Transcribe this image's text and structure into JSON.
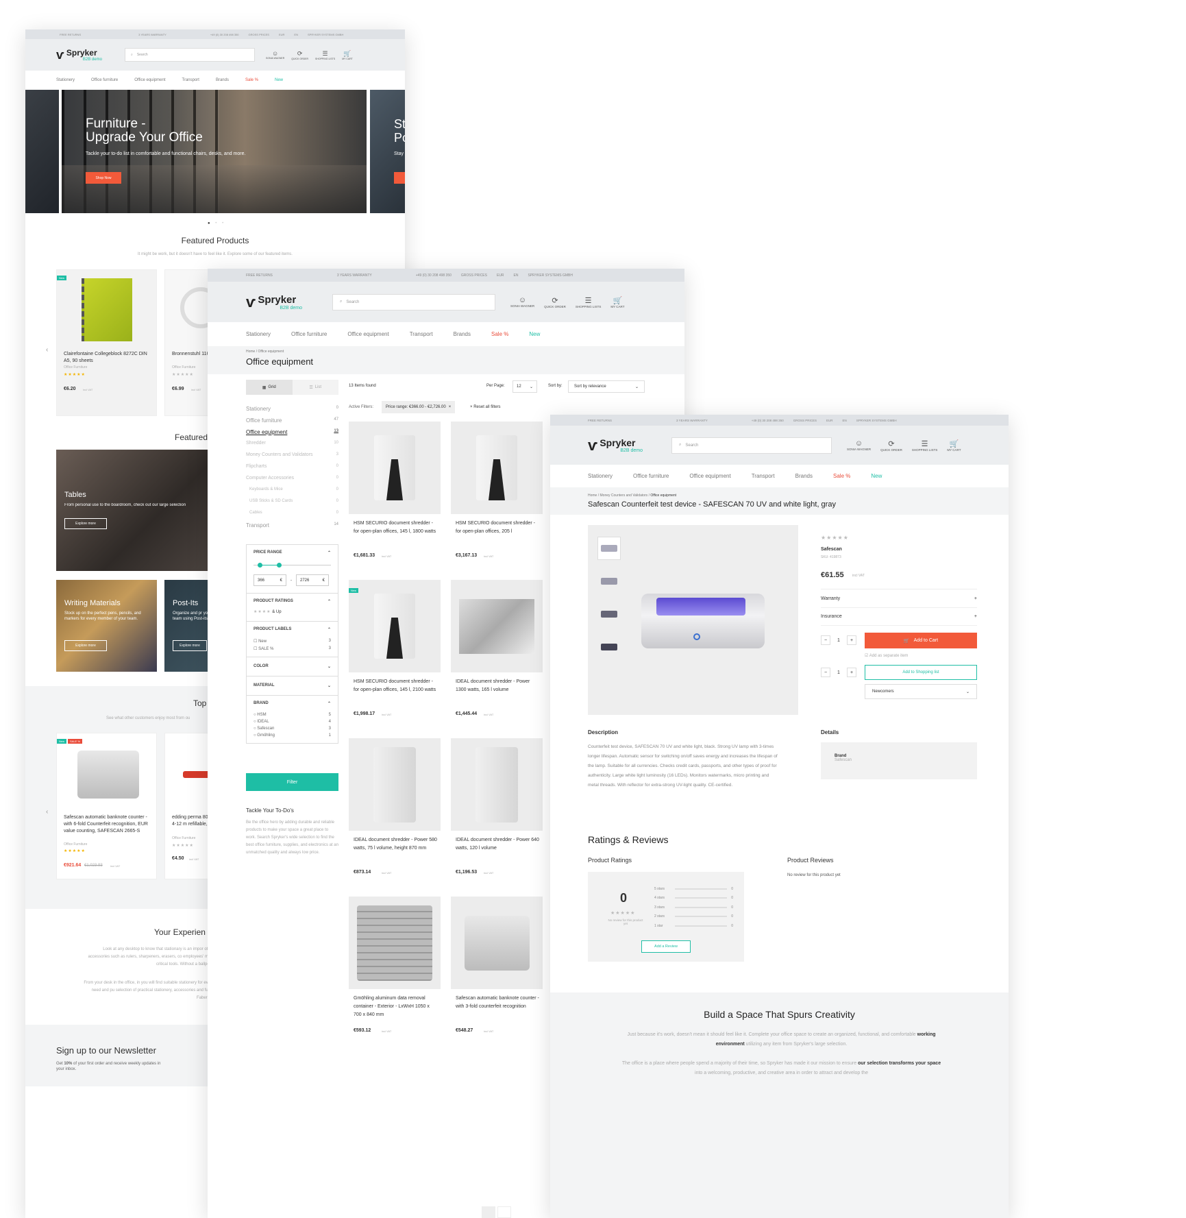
{
  "topbar": {
    "free_returns": "FREE RETURNS",
    "warranty": "3 YEARS WARRANTY",
    "phone": "+49 (0) 30 208 498 350",
    "gross_prices": "GROSS PRICES",
    "currency": "EUR",
    "language": "EN",
    "company": "SPRYKER SYSTEMS GMBH"
  },
  "header": {
    "logo_name": "Spryker",
    "logo_sub": "B2B demo",
    "search_placeholder": "Search",
    "user": "SONIA WAGNER",
    "quick_order": "QUICK ORDER",
    "shopping_lists": "SHOPPING LISTS",
    "cart": "MY CART",
    "cart_count": "3"
  },
  "nav": {
    "stationery": "Stationery",
    "office_furniture": "Office furniture",
    "office_equipment": "Office equipment",
    "transport": "Transport",
    "brands": "Brands",
    "sale": "Sale %",
    "new": "New"
  },
  "home": {
    "hero_title_1": "Furniture -",
    "hero_title_2": "Upgrade Your Office",
    "hero_text": "Tackle your to-do list in comfortable and functional chairs, desks, and more.",
    "hero_button": "Shop Now",
    "next_hero_1": "St",
    "next_hero_2": "Po",
    "next_hero_3": "Stay",
    "featured_title": "Featured Products",
    "featured_sub": "It might be work, but it doesn't have to feel like it. Explore some of our featured items.",
    "featured": [
      {
        "badge": "New",
        "name": "Clairefontaine Collegeblock 8272C DIN A5, 90 sheets",
        "category": "Office Furniture",
        "price": "€6.20",
        "vat": "incl VAT"
      },
      {
        "badge": "",
        "name": "Bronnenstuhl 1162180 3 m, b",
        "category": "Office Furniture",
        "price": "€6.99",
        "vat": "incl VAT"
      }
    ],
    "featured_cat_title": "Featured",
    "tables_title": "Tables",
    "tables_text": "From personal use to the boardroom, check out our large selection",
    "explore_more": "Explore more",
    "writing_title": "Writing Materials",
    "writing_text": "Stock up on the perfect pens, pencils, and markers for every member of your team.",
    "postits_title": "Post-Its",
    "postits_text": "Organize and pr your team using Post-its.",
    "top_title": "Top",
    "top_sub": "See what other customers enjoy most from ou",
    "top": [
      {
        "badge_new": "New",
        "badge_sale": "SALE %",
        "name": "Safescan automatic banknote counter - with 6-fold Counterfeit recognition, EUR value counting, SAFESCAN 2665-S",
        "category": "Office Furniture",
        "price": "€921.64",
        "old_price": "€1,023.93",
        "vat": "incl VAT"
      },
      {
        "name": "edding perma 800004 4-12 m refillable, blac",
        "category": "Office Furniture",
        "price": "€4.50",
        "vat": "incl VAT"
      }
    ],
    "experience_title": "Your Experien",
    "experience_p1": "Look at any desktop to know that stationary is an impor other accessories such as rulers, sharpeners, erasers, co employees' most critical tools. Without a ballpoint",
    "experience_p2": "From your desk in the office, in you will find suitable stationery for every need and pu selection of practical stationery, accessories and furnit Faber Ca",
    "newsletter_title": "Sign up to our Newsletter",
    "newsletter_text_1": "Get",
    "newsletter_bold": "10%",
    "newsletter_text_2": "of your first order and receive weekly updates in your inbox."
  },
  "catalog": {
    "breadcrumb_home": "Home",
    "breadcrumb_current": "Office equipment",
    "title": "Office equipment",
    "grid": "Grid",
    "list": "List",
    "items_found": "13 Items found",
    "per_page_label": "Per Page:",
    "per_page": "12",
    "sort_label": "Sort by:",
    "sort_value": "Sort by relevance",
    "active_filters": "Active Filters:",
    "price_range_chip": "Price range: €366.00 - €2,726.00",
    "reset_filters": "Reset all filters",
    "categories": [
      {
        "name": "Stationery",
        "count": "0"
      },
      {
        "name": "Office furniture",
        "count": "47"
      },
      {
        "name": "Office equipment",
        "count": "13"
      },
      {
        "name": "Shredder",
        "count": "10"
      },
      {
        "name": "Money Counters and Validators",
        "count": "3"
      },
      {
        "name": "Flipcharts",
        "count": "0"
      },
      {
        "name": "Computer Accessories",
        "count": "0"
      },
      {
        "name": "Keyboards & Mice",
        "count": "0"
      },
      {
        "name": "USB Sticks & SD Cards",
        "count": "0"
      },
      {
        "name": "Cables",
        "count": "0"
      },
      {
        "name": "Transport",
        "count": "14"
      }
    ],
    "price_range_label": "PRICE RANGE",
    "price_min": "366",
    "price_max": "2726",
    "price_unit": "€",
    "price_dash": "-",
    "ratings_label": "PRODUCT RATINGS",
    "ratings_up": "& Up",
    "labels_label": "PRODUCT LABELS",
    "label_new": "New",
    "label_new_count": "3",
    "label_sale": "SALE %",
    "label_sale_count": "3",
    "color_label": "COLOR",
    "material_label": "MATERIAL",
    "brand_label": "BRAND",
    "brands": [
      {
        "name": "HSM",
        "count": "5"
      },
      {
        "name": "IDEAL",
        "count": "4"
      },
      {
        "name": "Safescan",
        "count": "3"
      },
      {
        "name": "Gmöhling",
        "count": "1"
      }
    ],
    "filter_button": "Filter",
    "seo_title": "Tackle Your To-Do's",
    "seo_text": "Be the office hero by adding durable and reliable products to make your space a great place to work. Search Spryker's wide selection to find the best office furniture, supplies, and electronics at an unmatched quality and always low price.",
    "products": [
      {
        "name": "HSM SECURIO document shredder - for open-plan offices, 145 l, 1800 watts",
        "price": "€1,681.33",
        "vat": "incl VAT",
        "badge": ""
      },
      {
        "name": "HSM SECURIO document shredder - for open-plan offices, 205 l",
        "price": "€3,167.13",
        "vat": "incl VAT",
        "badge": ""
      },
      {
        "name": "HSM SECURIO document shredder - for open-plan offices, 145 l, 2100 watts",
        "price": "€1,998.17",
        "vat": "incl VAT",
        "badge": "New"
      },
      {
        "name": "IDEAL document shredder - Power 1300 watts, 165 l volume",
        "price": "€1,445.44",
        "vat": "incl VAT",
        "badge": ""
      },
      {
        "name": "IDEAL document shredder - Power 580 watts, 75 l volume, height 870 mm",
        "price": "€873.14",
        "vat": "incl VAT",
        "badge": ""
      },
      {
        "name": "IDEAL document shredder - Power 640 watts, 120 l volume",
        "price": "€1,196.53",
        "vat": "incl VAT",
        "badge": ""
      },
      {
        "name": "Gmöhling aluminum data removal container - Exterior - LxWxH 1050 x 700 x 840 mm",
        "price": "€593.12",
        "vat": "incl VAT",
        "badge": ""
      },
      {
        "name": "Safescan automatic banknote counter - with 3-fold counterfeit recognition",
        "price": "€548.27",
        "vat": "incl VAT",
        "badge": ""
      }
    ]
  },
  "pdp": {
    "breadcrumb_home": "Home",
    "breadcrumb_mid": "Money Counters and Validators",
    "breadcrumb_current": "Office equipment",
    "title": "Safescan Counterfeit test device - SAFESCAN 70 UV and white light, gray",
    "brand": "Safescan",
    "sku": "SKU: 419873",
    "price": "€61.55",
    "vat": "incl VAT",
    "warranty": "Warranty",
    "insurance": "Insurance",
    "qty": "1",
    "add_to_cart": "Add to Cart",
    "separate_item": "Add as separate item",
    "add_to_list": "Add to Shopping list",
    "list_select": "Newcomers",
    "description_title": "Description",
    "description": "Counterfeit test device, SAFESCAN 70 UV and white light, black. Strong UV lamp with 3-times longer lifespan. Automatic sensor for switching on/off saves energy and increases the lifespan of the lamp. Suitable for all currencies. Checks credit cards, passports, and other types of proof for authenticity. Large white light luminosity (16 LEDs). Monitors watermarks, micro printing and metal threads. With reflector for extra-strong UV-light quality. CE-certified.",
    "details_title": "Details",
    "details_brand_label": "Brand",
    "details_brand_value": "Safescan",
    "ratings_title": "Ratings & Reviews",
    "product_ratings": "Product Ratings",
    "rating_value": "0",
    "no_review_text": "No review for this product yet",
    "add_review": "Add a Review",
    "star_rows": [
      {
        "label": "5 stars",
        "count": "0"
      },
      {
        "label": "4 stars",
        "count": "0"
      },
      {
        "label": "3 stars",
        "count": "0"
      },
      {
        "label": "2 stars",
        "count": "0"
      },
      {
        "label": "1 star",
        "count": "0"
      }
    ],
    "product_reviews": "Product Reviews",
    "no_reviews": "No review for this product yet",
    "build_title": "Build a Space That Spurs Creativity",
    "build_p1a": "Just because it's work, doesn't mean it should feel like it. Complete your office space to create an organized, functional, and comfortable",
    "build_p1b": "working environment",
    "build_p1c": "utilizing any item from Spryker's large selection.",
    "build_p2a": "The office is a place where people spend a majority of their time, so Spryker has made it our mission to ensure",
    "build_p2b": "our selection transforms your space",
    "build_p2c": "into a welcoming, productive, and creative area in order to attract and develop the"
  },
  "colors": {
    "accent_green": "#1ebea5",
    "accent_red": "#f25a3a",
    "header_bg": "#eceef0"
  }
}
